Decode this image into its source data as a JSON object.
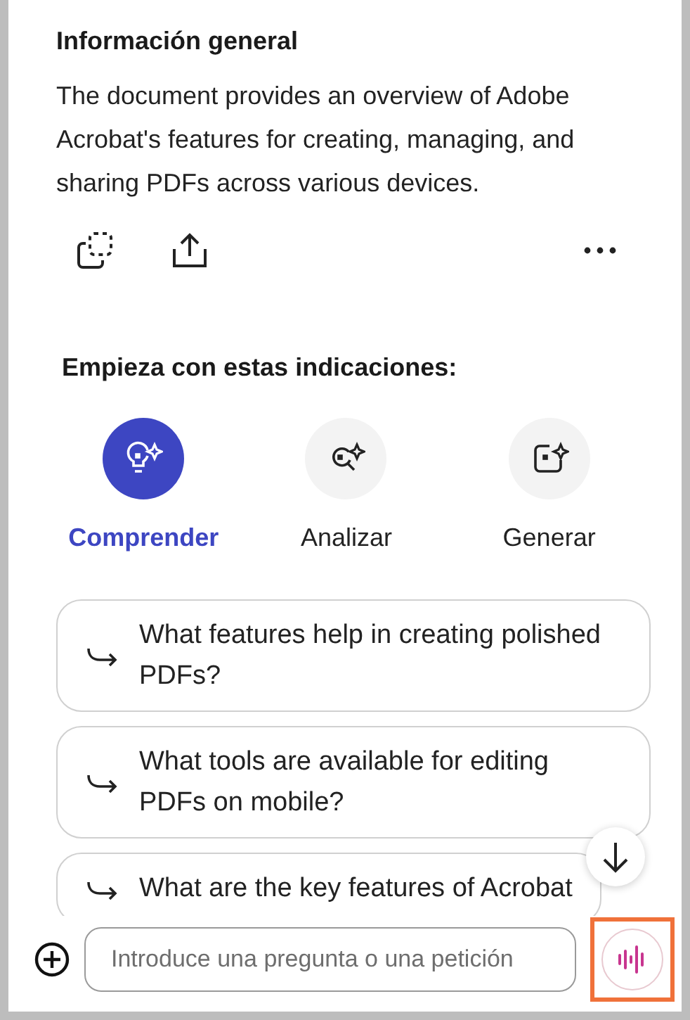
{
  "summary": {
    "title": "Información general",
    "text": "The document provides an overview of Adobe Acrobat's features for creating, managing, and sharing PDFs across various devices."
  },
  "prompts_heading": "Empieza con estas indicaciones:",
  "categories": [
    {
      "label": "Comprender",
      "kind": "understand",
      "selected": true
    },
    {
      "label": "Analizar",
      "kind": "analyze",
      "selected": false
    },
    {
      "label": "Generar",
      "kind": "generate",
      "selected": false
    }
  ],
  "suggestions": [
    "What features help in creating polished PDFs?",
    "What tools are available for editing PDFs on mobile?",
    "What are the key features of Acrobat"
  ],
  "input": {
    "placeholder": "Introduce una pregunta o una petición"
  }
}
